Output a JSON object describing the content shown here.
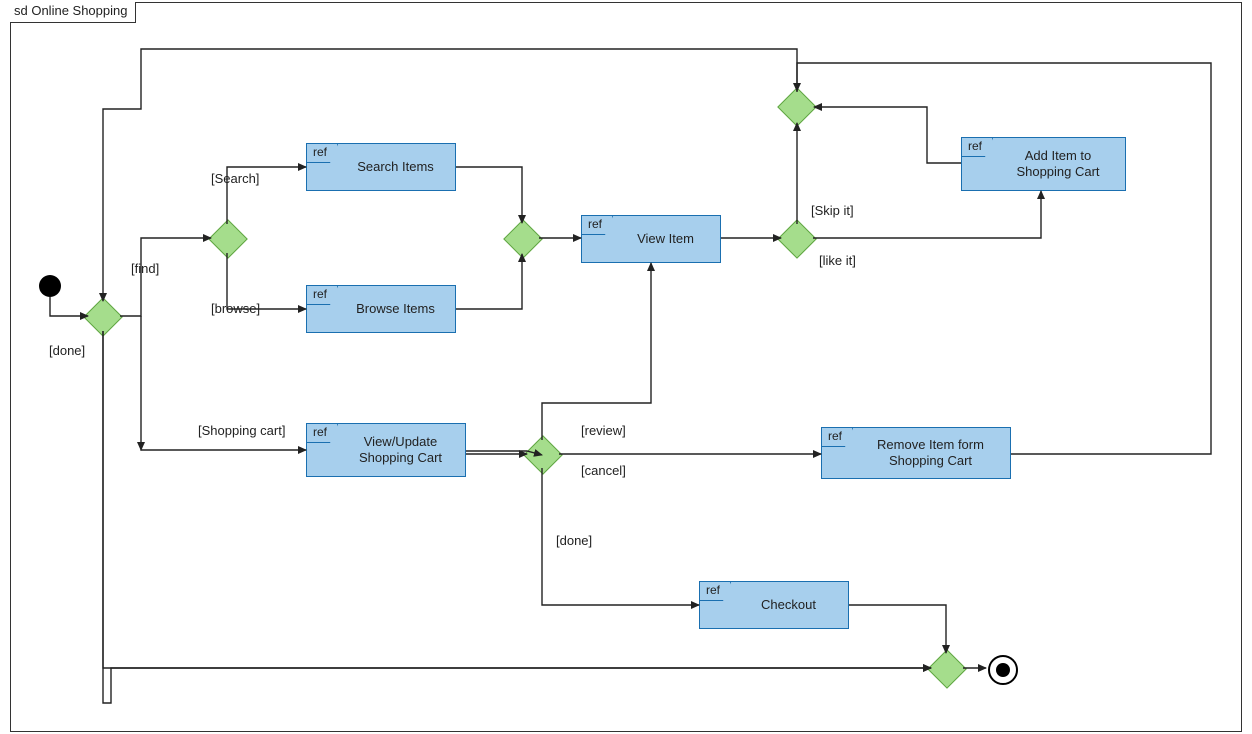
{
  "frame": {
    "title": "sd Online Shopping"
  },
  "refTab": "ref",
  "refs": {
    "searchItems": "Search Items",
    "browseItems": "Browse Items",
    "viewItem": "View Item",
    "addItem": "Add Item to Shopping Cart",
    "viewUpdateCart": "View/Update Shopping Cart",
    "removeItem": "Remove Item form Shopping Cart",
    "checkout": "Checkout"
  },
  "guards": {
    "find": "[find]",
    "doneTop": "[done]",
    "search": "[Search]",
    "browse": "[browse]",
    "shoppingCart": "[Shopping cart]",
    "skipIt": "[Skip it]",
    "likeIt": "[like it]",
    "review": "[review]",
    "cancel": "[cancel]",
    "doneMid": "[done]"
  }
}
